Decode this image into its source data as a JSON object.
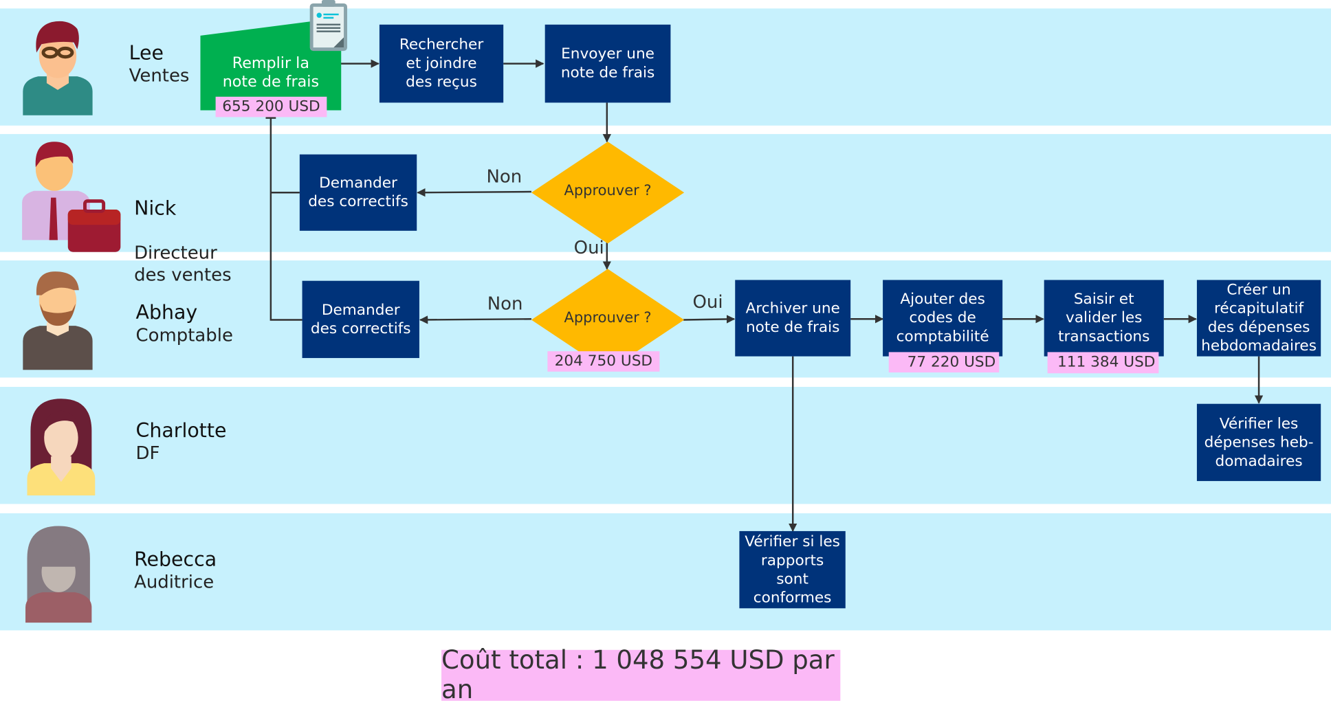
{
  "lanes": [
    {
      "name": "Lee",
      "role": "Ventes",
      "avatar": "man-glasses-avatar"
    },
    {
      "name": "Nick",
      "role": "Directeur\ndes ventes",
      "avatar": "manager-briefcase-avatar"
    },
    {
      "name": "Abhay",
      "role": "Comptable",
      "avatar": "bearded-man-avatar"
    },
    {
      "name": "Charlotte",
      "role": "DF",
      "avatar": "woman-avatar"
    },
    {
      "name": "Rebecca",
      "role": "Auditrice",
      "avatar": "woman-gray-avatar"
    }
  ],
  "steps": {
    "fill_report": {
      "label": "Remplir la\nnote de frais",
      "cost": "655 200 USD",
      "icon": "clipboard-form-icon"
    },
    "find_receipts": {
      "label": "Rechercher\net joindre\ndes reçus"
    },
    "send_report": {
      "label": "Envoyer une\nnote de frais"
    },
    "approve_nick": {
      "label": "Approuver ?"
    },
    "fix_nick": {
      "label": "Demander\ndes correctifs"
    },
    "approve_abhay": {
      "label": "Approuver ?",
      "cost": "204 750 USD"
    },
    "fix_abhay": {
      "label": "Demander\ndes correctifs"
    },
    "archive": {
      "label": "Archiver une\nnote de frais"
    },
    "add_codes": {
      "label": "Ajouter des\ncodes de\ncomptabilité",
      "cost": "77 220 USD"
    },
    "enter_validate": {
      "label": "Saisir et\nvalider les\ntransactions",
      "cost": "111 384 USD"
    },
    "weekly_summary": {
      "label": "Créer un\nrécapitulatif\ndes dépenses\nhebdomadaires"
    },
    "review_weekly": {
      "label": "Vérifier les\ndépenses heb-\ndomadaires"
    },
    "check_compliance": {
      "label": "Vérifier si les\nrapports sont\nconformes"
    }
  },
  "edge_labels": {
    "nick_no": "Non",
    "nick_yes": "Oui",
    "abhay_no": "Non",
    "abhay_yes": "Oui"
  },
  "total": "Coût total : 1 048 554 USD par an",
  "colors": {
    "lane": "#c7f1fd",
    "task": "#00337a",
    "start_task": "#00b050",
    "decision": "#ffb900",
    "cost_tag": "#fbb9f6",
    "connector": "#333333"
  }
}
